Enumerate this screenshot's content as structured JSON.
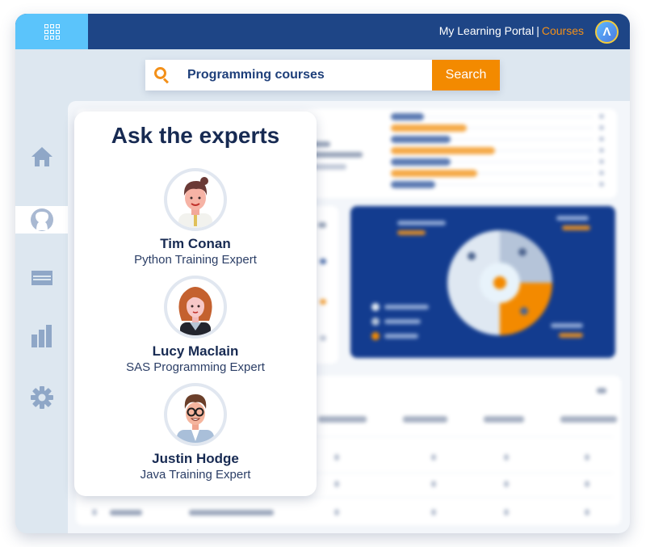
{
  "header": {
    "apps_icon": "grid-icon",
    "portal_title": "My Learning Portal",
    "separator": "|",
    "section": "Courses",
    "user_avatar_letter": "Λ"
  },
  "search": {
    "icon": "search-icon",
    "value": "Programming courses",
    "button_label": "Search"
  },
  "sidebar": {
    "items": [
      {
        "name": "home",
        "icon": "home-icon",
        "active": false
      },
      {
        "name": "profile",
        "icon": "user-icon",
        "active": true
      },
      {
        "name": "courses",
        "icon": "card-icon",
        "active": false
      },
      {
        "name": "reports",
        "icon": "bar-chart-icon",
        "active": false
      },
      {
        "name": "settings",
        "icon": "gear-icon",
        "active": false
      }
    ]
  },
  "experts_panel": {
    "title": "Ask the experts",
    "experts": [
      {
        "name": "Tim Conan",
        "role": "Python Training Expert"
      },
      {
        "name": "Lucy Maclain",
        "role": "SAS Programming Expert"
      },
      {
        "name": "Justin Hodge",
        "role": "Java Training Expert"
      }
    ]
  },
  "background_dashboard": {
    "bar_chart": {
      "series_colors": [
        "#5c7bb3",
        "#f5a947"
      ],
      "bar_fractions": [
        0.15,
        0.34,
        0.27,
        0.47,
        0.27,
        0.39,
        0.2
      ]
    },
    "status_pie": {
      "colors": {
        "completed": "#dfe8f2",
        "ongoing": "#b5c4d9",
        "expired": "#f38a00"
      },
      "slice_fractions": {
        "completed": 0.5,
        "ongoing": 0.25,
        "expired": 0.25
      }
    }
  }
}
